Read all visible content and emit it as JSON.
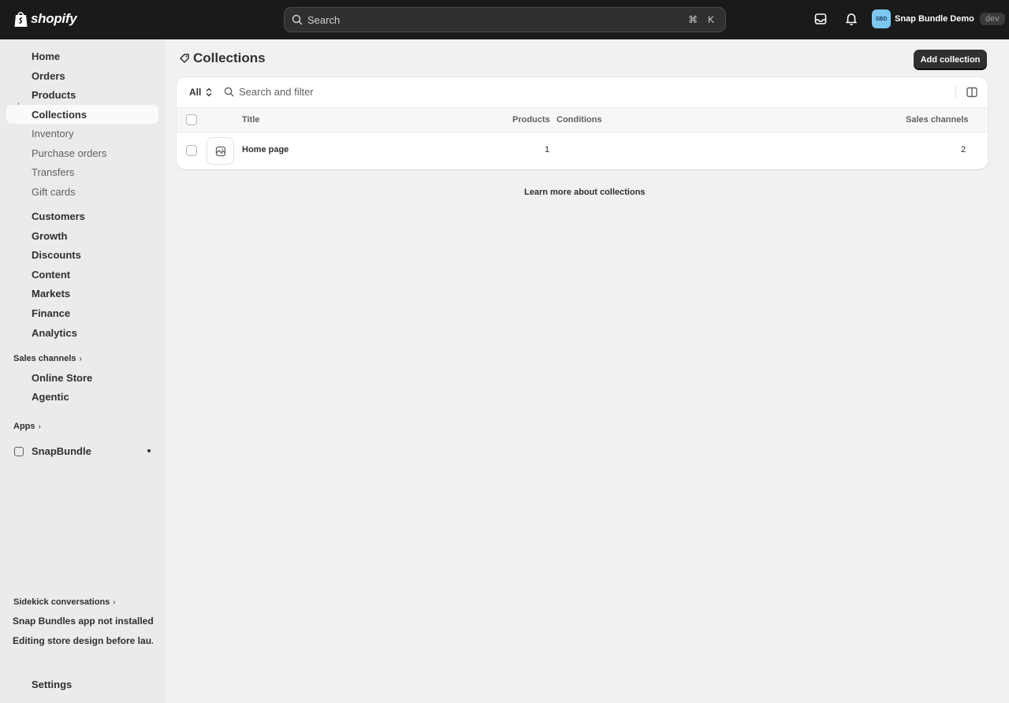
{
  "topbar": {
    "logo_text": "shopify",
    "search_placeholder": "Search",
    "shortcut_cmd": "⌘",
    "shortcut_key": "K",
    "store_initials": "SBD",
    "store_name": "Snap Bundle Demo",
    "env_badge": "dev"
  },
  "sidebar": {
    "items": [
      {
        "label": "Home"
      },
      {
        "label": "Orders"
      },
      {
        "label": "Products"
      },
      {
        "label": "Collections"
      },
      {
        "label": "Inventory"
      },
      {
        "label": "Purchase orders"
      },
      {
        "label": "Transfers"
      },
      {
        "label": "Gift cards"
      },
      {
        "label": "Customers"
      },
      {
        "label": "Growth"
      },
      {
        "label": "Discounts"
      },
      {
        "label": "Content"
      },
      {
        "label": "Markets"
      },
      {
        "label": "Finance"
      },
      {
        "label": "Analytics"
      }
    ],
    "sales_channels_label": "Sales channels",
    "sales_channels": [
      {
        "label": "Online Store"
      },
      {
        "label": "Agentic"
      }
    ],
    "apps_label": "Apps",
    "apps": [
      {
        "label": "SnapBundle"
      }
    ],
    "sidekick_label": "Sidekick conversations",
    "sidekick_items": [
      {
        "label": "Snap Bundles app not installed"
      },
      {
        "label": "Editing store design before lau..."
      }
    ],
    "settings_label": "Settings"
  },
  "page": {
    "title": "Collections",
    "add_button": "Add collection",
    "filter_tab": "All",
    "filter_placeholder": "Search and filter",
    "columns": {
      "title": "Title",
      "products": "Products",
      "conditions": "Conditions",
      "sales_channels": "Sales channels"
    },
    "rows": [
      {
        "title": "Home page",
        "products": "1",
        "conditions": "",
        "sales_channels": "2"
      }
    ],
    "learn_more": "Learn more about collections"
  }
}
